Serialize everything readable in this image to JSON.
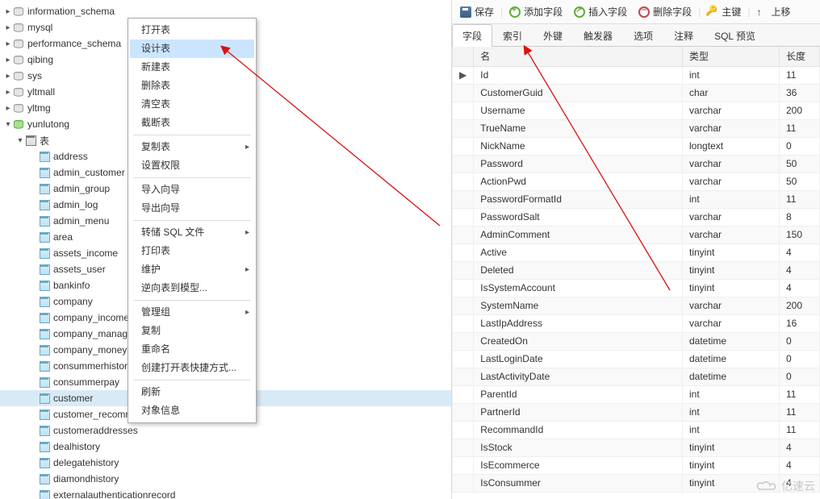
{
  "tree": {
    "databases": [
      "information_schema",
      "mysql",
      "performance_schema",
      "qibing",
      "sys",
      "yltmall",
      "yltmg"
    ],
    "active_db": "yunlutong",
    "tables_label": "表",
    "tables": [
      "address",
      "admin_customer",
      "admin_group",
      "admin_log",
      "admin_menu",
      "area",
      "assets_income",
      "assets_user",
      "bankinfo",
      "company",
      "company_income",
      "company_manager",
      "company_money",
      "consummerhistory",
      "consummerpay",
      "customer",
      "customer_recommends",
      "customeraddresses",
      "dealhistory",
      "delegatehistory",
      "diamondhistory",
      "externalauthenticationrecord"
    ],
    "selected_table": "customer"
  },
  "contextMenu": {
    "items": [
      {
        "label": "打开表"
      },
      {
        "label": "设计表",
        "hover": true
      },
      {
        "label": "新建表"
      },
      {
        "label": "删除表"
      },
      {
        "label": "清空表"
      },
      {
        "label": "截断表"
      },
      {
        "sep": true
      },
      {
        "label": "复制表",
        "sub": true
      },
      {
        "label": "设置权限"
      },
      {
        "sep": true
      },
      {
        "label": "导入向导"
      },
      {
        "label": "导出向导"
      },
      {
        "sep": true
      },
      {
        "label": "转储 SQL 文件",
        "sub": true
      },
      {
        "label": "打印表"
      },
      {
        "label": "维护",
        "sub": true
      },
      {
        "label": "逆向表到模型..."
      },
      {
        "sep": true
      },
      {
        "label": "管理组",
        "sub": true
      },
      {
        "label": "复制"
      },
      {
        "label": "重命名"
      },
      {
        "label": "创建打开表快捷方式..."
      },
      {
        "sep": true
      },
      {
        "label": "刷新"
      },
      {
        "label": "对象信息"
      }
    ]
  },
  "toolbar": {
    "save": "保存",
    "addField": "添加字段",
    "insField": "插入字段",
    "delField": "删除字段",
    "pkey": "主键",
    "moveUp": "上移"
  },
  "tabs": [
    "字段",
    "索引",
    "外键",
    "触发器",
    "选项",
    "注释",
    "SQL 预览"
  ],
  "activeTab": 0,
  "grid": {
    "headers": {
      "name": "名",
      "type": "类型",
      "length": "长度"
    },
    "rows": [
      {
        "ptr": "▶",
        "name": "Id",
        "type": "int",
        "length": "11"
      },
      {
        "name": "CustomerGuid",
        "type": "char",
        "length": "36"
      },
      {
        "name": "Username",
        "type": "varchar",
        "length": "200"
      },
      {
        "name": "TrueName",
        "type": "varchar",
        "length": "11"
      },
      {
        "name": "NickName",
        "type": "longtext",
        "length": "0"
      },
      {
        "name": "Password",
        "type": "varchar",
        "length": "50"
      },
      {
        "name": "ActionPwd",
        "type": "varchar",
        "length": "50"
      },
      {
        "name": "PasswordFormatId",
        "type": "int",
        "length": "11"
      },
      {
        "name": "PasswordSalt",
        "type": "varchar",
        "length": "8"
      },
      {
        "name": "AdminComment",
        "type": "varchar",
        "length": "150"
      },
      {
        "name": "Active",
        "type": "tinyint",
        "length": "4"
      },
      {
        "name": "Deleted",
        "type": "tinyint",
        "length": "4"
      },
      {
        "name": "IsSystemAccount",
        "type": "tinyint",
        "length": "4"
      },
      {
        "name": "SystemName",
        "type": "varchar",
        "length": "200"
      },
      {
        "name": "LastIpAddress",
        "type": "varchar",
        "length": "16"
      },
      {
        "name": "CreatedOn",
        "type": "datetime",
        "length": "0"
      },
      {
        "name": "LastLoginDate",
        "type": "datetime",
        "length": "0"
      },
      {
        "name": "LastActivityDate",
        "type": "datetime",
        "length": "0"
      },
      {
        "name": "ParentId",
        "type": "int",
        "length": "11"
      },
      {
        "name": "PartnerId",
        "type": "int",
        "length": "11"
      },
      {
        "name": "RecommandId",
        "type": "int",
        "length": "11"
      },
      {
        "name": "IsStock",
        "type": "tinyint",
        "length": "4"
      },
      {
        "name": "IsEcommerce",
        "type": "tinyint",
        "length": "4"
      },
      {
        "name": "IsConsummer",
        "type": "tinyint",
        "length": "4"
      }
    ]
  },
  "watermark": "亿速云"
}
